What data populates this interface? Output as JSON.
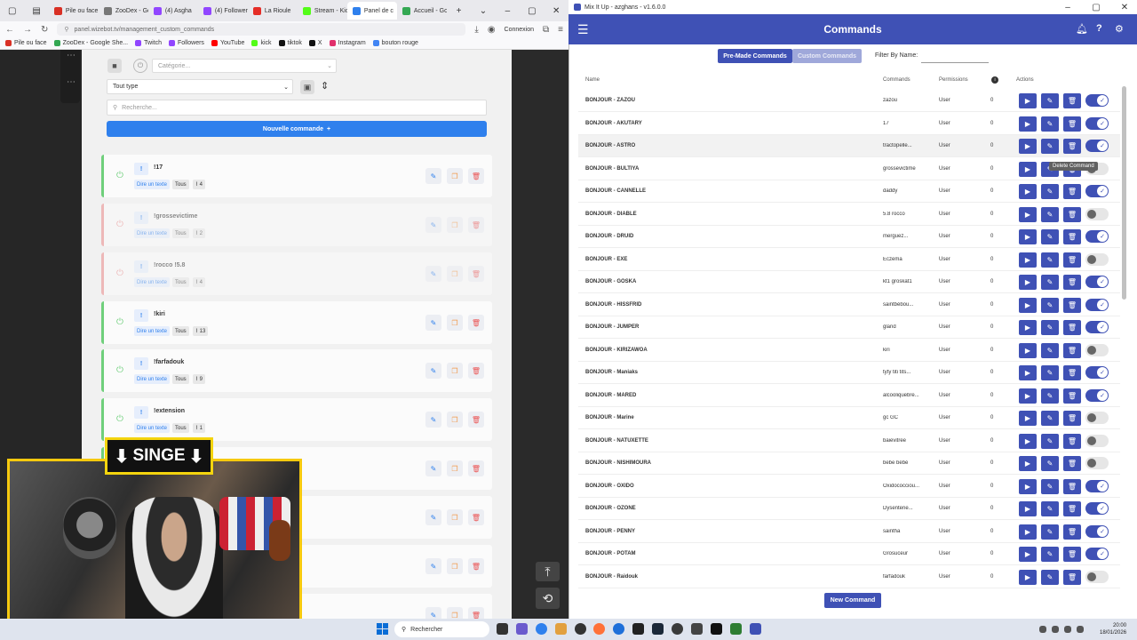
{
  "browser": {
    "tabs": [
      {
        "label": "Pile ou face",
        "color": "#d93025"
      },
      {
        "label": "ZooDex - Go",
        "color": "#777"
      },
      {
        "label": "(4) Asgha",
        "color": "#9146ff"
      },
      {
        "label": "(4) Followers",
        "color": "#9146ff"
      },
      {
        "label": "La Rioule",
        "color": "#e52d27"
      },
      {
        "label": "Stream - Kick",
        "color": "#53fc18"
      },
      {
        "label": "Panel de c",
        "color": "#2f80ed"
      },
      {
        "label": "Accueil - Goo",
        "color": "#34a853"
      }
    ],
    "connexion_label": "Connexion",
    "url": "panel.wizebot.tv/management_custom_commands",
    "bookmarks": [
      {
        "label": "Pile ou face",
        "color": "#d93025"
      },
      {
        "label": "ZooDex - Google She...",
        "color": "#34a853"
      },
      {
        "label": "Twitch",
        "color": "#9146ff"
      },
      {
        "label": "Followers",
        "color": "#9146ff"
      },
      {
        "label": "YouTube",
        "color": "#ff0000"
      },
      {
        "label": "kick",
        "color": "#53fc18"
      },
      {
        "label": "tiktok",
        "color": "#111111"
      },
      {
        "label": "X",
        "color": "#111111"
      },
      {
        "label": "Instagram",
        "color": "#e1306c"
      },
      {
        "label": "bouton rouge",
        "color": "#4285f4"
      }
    ]
  },
  "wizebot": {
    "category_placeholder": "Catégorie...",
    "type_select": "Tout type",
    "search_placeholder": "Recherche...",
    "new_command_label": "Nouvelle commande",
    "new_command_icon": "+",
    "commands": [
      {
        "name": "!17",
        "enabled": true,
        "count": "4"
      },
      {
        "name": "!grossevictime",
        "enabled": false,
        "count": "2"
      },
      {
        "name": "!rocco !5.8",
        "enabled": false,
        "count": "4"
      },
      {
        "name": "!kiri",
        "enabled": true,
        "count": "13"
      },
      {
        "name": "!farfadouk",
        "enabled": true,
        "count": "9"
      },
      {
        "name": "!extension",
        "enabled": true,
        "count": "1"
      }
    ],
    "tag_say": "Dire un texte",
    "tag_all": "Tous",
    "bang_label": "!"
  },
  "overlay": {
    "singe_label": "SINGE",
    "arrow_glyph": "⬇"
  },
  "mixitup": {
    "window_title": "Mix It Up - azghans - v1.6.0.0",
    "header_title": "Commands",
    "tab_premade": "Pre-Made Commands",
    "tab_custom": "Custom Commands",
    "filter_label": "Filter By Name:",
    "columns": {
      "name": "Name",
      "commands": "Commands",
      "permissions": "Permissions",
      "actions": "Actions"
    },
    "tooltip": "Delete Command",
    "new_command_button": "New Command",
    "rows": [
      {
        "name": "BONJOUR - ZAZOU",
        "command": "zazou",
        "permission": "User",
        "count": "0",
        "enabled": true
      },
      {
        "name": "BONJOUR - AKUTARY",
        "command": "17",
        "permission": "User",
        "count": "0",
        "enabled": true
      },
      {
        "name": "BONJOUR - ASTRO",
        "command": "tractopelle...",
        "permission": "User",
        "count": "0",
        "enabled": true
      },
      {
        "name": "BONJOUR - BULTIYA",
        "command": "grossevictime",
        "permission": "User",
        "count": "0",
        "enabled": false
      },
      {
        "name": "BONJOUR - CANNELLE",
        "command": "daddy",
        "permission": "User",
        "count": "0",
        "enabled": true
      },
      {
        "name": "BONJOUR - DIABLE",
        "command": "5.8 rocco",
        "permission": "User",
        "count": "0",
        "enabled": false
      },
      {
        "name": "BONJOUR - DRUID",
        "command": "merguez...",
        "permission": "User",
        "count": "0",
        "enabled": true
      },
      {
        "name": "BONJOUR - EXE",
        "command": "Eczema",
        "permission": "User",
        "count": "0",
        "enabled": false
      },
      {
        "name": "BONJOUR - GOSKA",
        "command": "kt1 groskat1",
        "permission": "User",
        "count": "0",
        "enabled": true
      },
      {
        "name": "BONJOUR - HISSFRID",
        "command": "saintbébou...",
        "permission": "User",
        "count": "0",
        "enabled": true
      },
      {
        "name": "BONJOUR - JUMPER",
        "command": "gland",
        "permission": "User",
        "count": "0",
        "enabled": true
      },
      {
        "name": "BONJOUR - KIRIZAWOA",
        "command": "kiri",
        "permission": "User",
        "count": "0",
        "enabled": false
      },
      {
        "name": "BONJOUR - Maniaks",
        "command": "tyty titi tits...",
        "permission": "User",
        "count": "0",
        "enabled": true
      },
      {
        "name": "BONJOUR - MARED",
        "command": "alcooliquebre...",
        "permission": "User",
        "count": "0",
        "enabled": true
      },
      {
        "name": "BONJOUR - Marine",
        "command": "gc GC",
        "permission": "User",
        "count": "0",
        "enabled": false
      },
      {
        "name": "BONJOUR - NATUXETTE",
        "command": "baievitree",
        "permission": "User",
        "count": "0",
        "enabled": false
      },
      {
        "name": "BONJOUR - NISHIMOURA",
        "command": "bebe bébé",
        "permission": "User",
        "count": "0",
        "enabled": false
      },
      {
        "name": "BONJOUR - OXIDO",
        "command": "Oxidococciou...",
        "permission": "User",
        "count": "0",
        "enabled": true
      },
      {
        "name": "BONJOUR - OZONE",
        "command": "Dysenterie...",
        "permission": "User",
        "count": "0",
        "enabled": true
      },
      {
        "name": "BONJOUR - PENNY",
        "command": "saintha",
        "permission": "User",
        "count": "0",
        "enabled": true
      },
      {
        "name": "BONJOUR - POTAM",
        "command": "Grosuceur",
        "permission": "User",
        "count": "0",
        "enabled": true
      },
      {
        "name": "BONJOUR - Raidouk",
        "command": "farfadouk",
        "permission": "User",
        "count": "0",
        "enabled": false
      }
    ]
  },
  "taskbar": {
    "search_label": "Rechercher",
    "time": "20:00",
    "date": "18/01/2026"
  }
}
